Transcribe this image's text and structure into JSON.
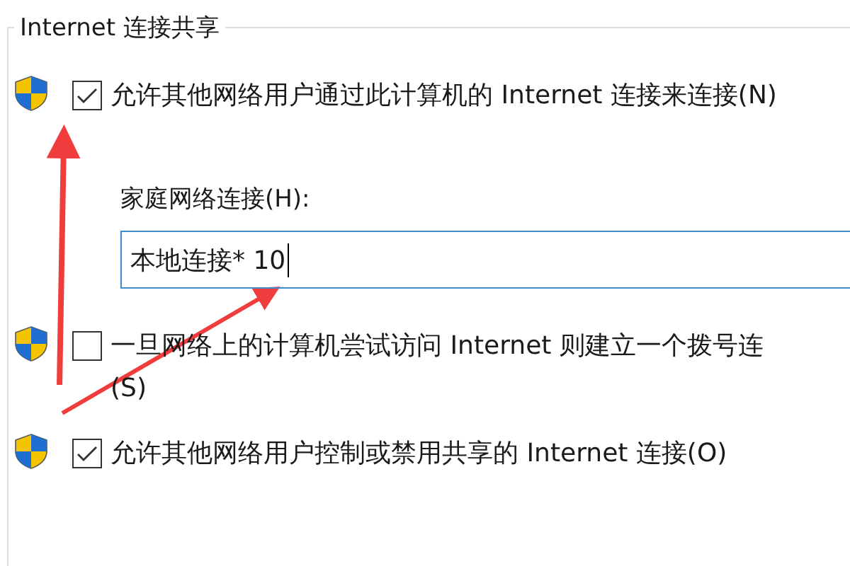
{
  "group": {
    "title": "Internet 连接共享"
  },
  "options": [
    {
      "kind": "checkbox",
      "checked": true,
      "lines": [
        "允许其他网络用户通过此计算机的 Internet 连接来连接(N)"
      ]
    },
    {
      "kind": "field",
      "label": "家庭网络连接(H):",
      "value": "本地连接* 10"
    },
    {
      "kind": "checkbox",
      "checked": false,
      "lines": [
        "一旦网络上的计算机尝试访问 Internet 则建立一个拨号连",
        "(S)"
      ]
    },
    {
      "kind": "checkbox",
      "checked": true,
      "lines": [
        "允许其他网络用户控制或禁用共享的 Internet 连接(O)"
      ]
    }
  ]
}
